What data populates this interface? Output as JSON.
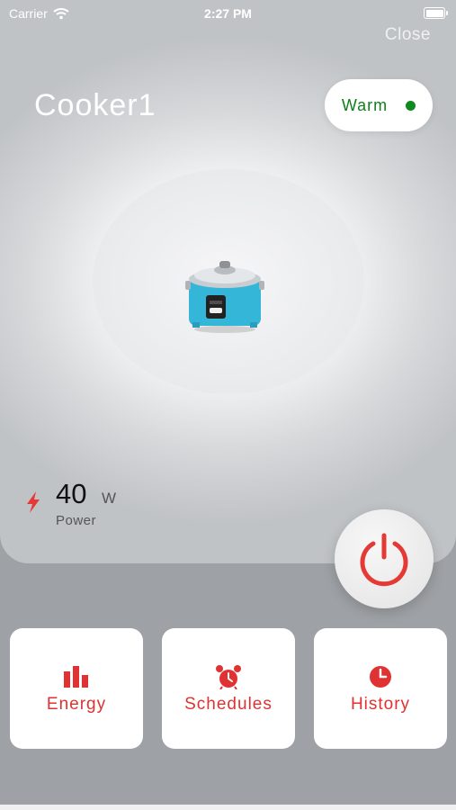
{
  "status_bar": {
    "carrier": "Carrier",
    "time": "2:27 PM"
  },
  "header": {
    "close_label": "Close",
    "device_name": "Cooker1"
  },
  "state": {
    "label": "Warm",
    "indicator_color": "#0e8a1e"
  },
  "power": {
    "value": "40",
    "unit": "W",
    "label": "Power",
    "icon": "lightning-icon"
  },
  "power_button": {
    "icon": "power-icon",
    "color": "#e53935"
  },
  "tiles": [
    {
      "label": "Energy",
      "icon": "bar-chart-icon"
    },
    {
      "label": "Schedules",
      "icon": "alarm-clock-icon"
    },
    {
      "label": "History",
      "icon": "clock-icon"
    }
  ],
  "colors": {
    "accent": "#e03232",
    "state_text": "#0e7f1a"
  }
}
